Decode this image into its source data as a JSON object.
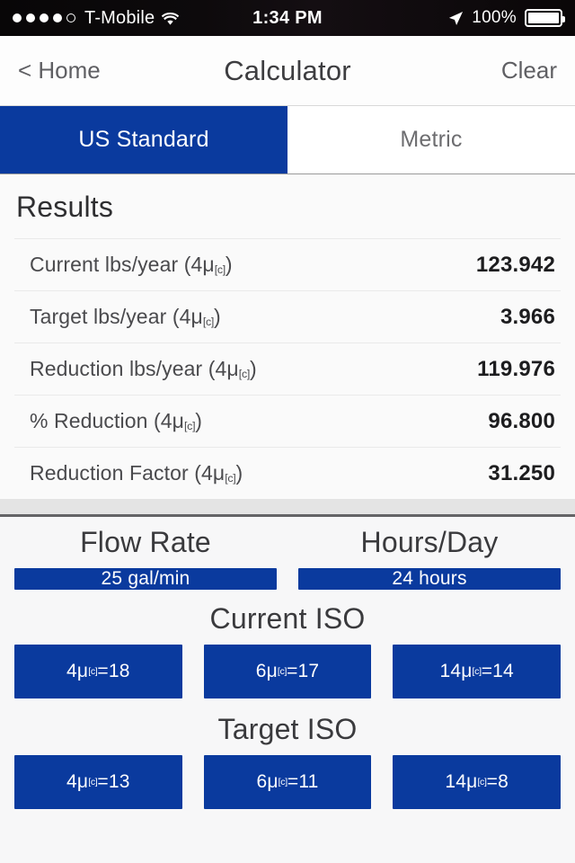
{
  "status_bar": {
    "carrier": "T-Mobile",
    "signal_dots_total": 5,
    "signal_dots_filled": 4,
    "wifi_icon": "wifi-icon",
    "time": "1:34 PM",
    "location_icon": "location-arrow-icon",
    "battery_percent": "100%",
    "battery_icon": "battery-full-icon"
  },
  "nav": {
    "back_label": "< Home",
    "title": "Calculator",
    "clear_label": "Clear"
  },
  "tabs": {
    "items": [
      {
        "label": "US Standard",
        "active": true
      },
      {
        "label": "Metric",
        "active": false
      }
    ]
  },
  "results": {
    "title": "Results",
    "rows": [
      {
        "label_prefix": "Current lbs/year (4μ",
        "label_sub": "[c]",
        "label_suffix": ")",
        "value": "123.942"
      },
      {
        "label_prefix": "Target lbs/year (4μ",
        "label_sub": "[c]",
        "label_suffix": ")",
        "value": "3.966"
      },
      {
        "label_prefix": "Reduction lbs/year (4μ",
        "label_sub": "[c]",
        "label_suffix": ")",
        "value": "119.976"
      },
      {
        "label_prefix": "% Reduction (4μ",
        "label_sub": "[c]",
        "label_suffix": ")",
        "value": "96.800"
      },
      {
        "label_prefix": "Reduction Factor (4μ",
        "label_sub": "[c]",
        "label_suffix": ")",
        "value": "31.250"
      }
    ]
  },
  "inputs": {
    "flow_rate": {
      "title": "Flow Rate",
      "value": "25 gal/min"
    },
    "hours_day": {
      "title": "Hours/Day",
      "value": "24 hours"
    },
    "current_iso": {
      "title": "Current ISO",
      "buttons": [
        {
          "prefix": "4μ",
          "sub": "[c]",
          "suffix": "=18"
        },
        {
          "prefix": "6μ",
          "sub": "[c]",
          "suffix": "=17"
        },
        {
          "prefix": "14μ",
          "sub": "[c]",
          "suffix": "=14"
        }
      ]
    },
    "target_iso": {
      "title": "Target ISO",
      "buttons": [
        {
          "prefix": "4μ",
          "sub": "[c]",
          "suffix": "=13"
        },
        {
          "prefix": "6μ",
          "sub": "[c]",
          "suffix": "=11"
        },
        {
          "prefix": "14μ",
          "sub": "[c]",
          "suffix": "=8"
        }
      ]
    }
  },
  "colors": {
    "brand_blue": "#0A3A9E",
    "panel_bg": "#FAFAFA",
    "page_bg": "#F7F7F8",
    "separator": "#646466"
  }
}
